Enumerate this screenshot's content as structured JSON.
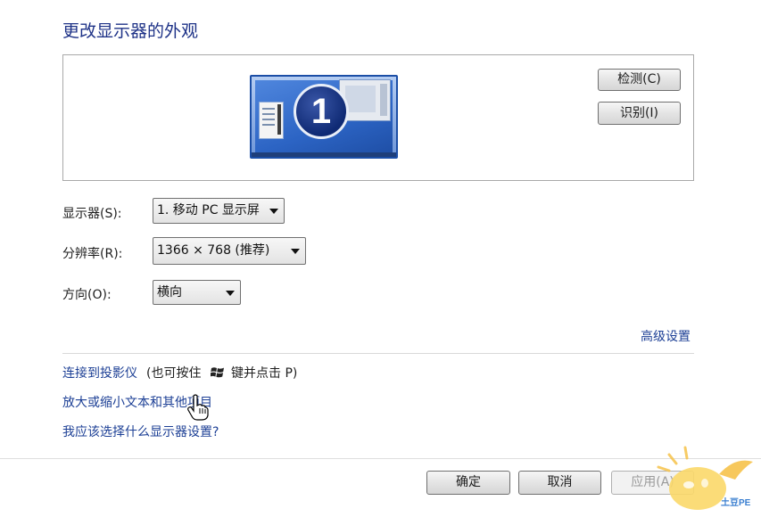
{
  "page": {
    "title": "更改显示器的外观"
  },
  "preview": {
    "monitor_number": "1",
    "detect_button": "检测(C)",
    "identify_button": "识别(I)"
  },
  "settings": {
    "display_label": "显示器(S):",
    "display_value": "1. 移动 PC 显示屏",
    "resolution_label": "分辨率(R):",
    "resolution_value": "1366 × 768 (推荐)",
    "orientation_label": "方向(O):",
    "orientation_value": "横向"
  },
  "links": {
    "advanced": "高级设置",
    "projector": "连接到投影仪",
    "projector_hint_prefix": "(也可按住",
    "projector_hint_suffix": "键并点击 P)",
    "text_size": "放大或缩小文本和其他项目",
    "which_settings": "我应该选择什么显示器设置?"
  },
  "footer": {
    "ok_button": "确定",
    "cancel_button": "取消",
    "apply_button": "应用(A)"
  },
  "watermark": {
    "text": "土豆PE"
  },
  "colors": {
    "title": "#1e3287",
    "link": "#1c3f95",
    "monitor_frame": "#1b4ea6"
  }
}
